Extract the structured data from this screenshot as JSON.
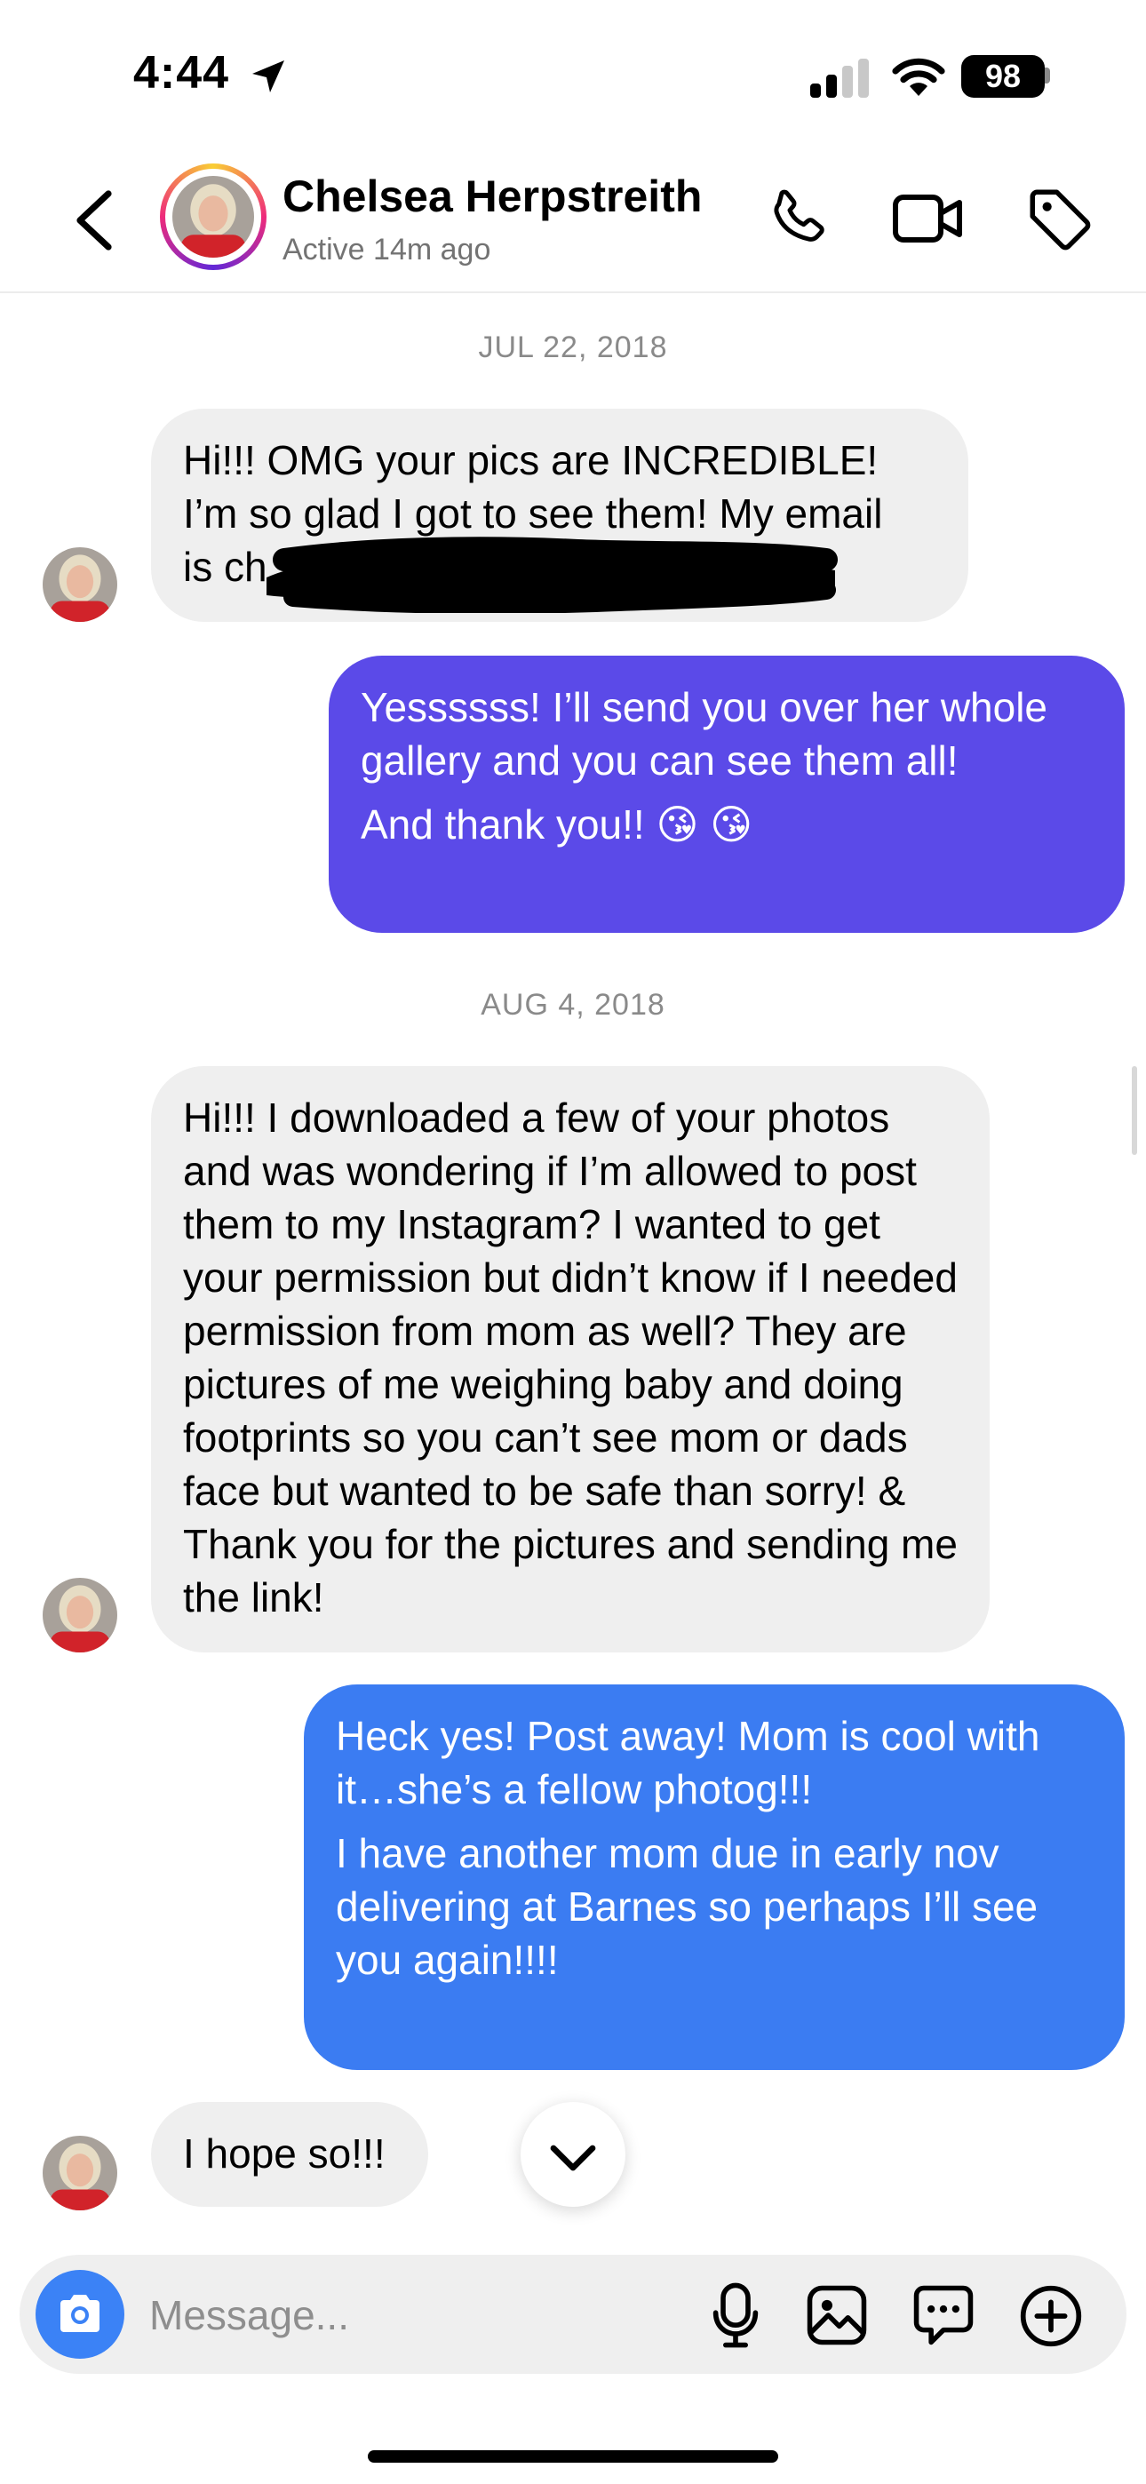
{
  "status_bar": {
    "time": "4:44",
    "battery": "98"
  },
  "header": {
    "name": "Chelsea Herpstreith",
    "status": "Active 14m ago"
  },
  "colors": {
    "outgoing_1": "#5b4ae8",
    "outgoing_2": "#3b7cf2",
    "incoming": "#efefef",
    "accent": "#3b82f6"
  },
  "messages": {
    "date_1": "JUL 22, 2018",
    "in_1": {
      "line1": "Hi!!! OMG your pics are INCREDIBLE!",
      "line2": "I’m so glad I got to see them! My email",
      "line3": "is ch"
    },
    "out_1": {
      "p1": "Yessssss! I’ll send you over her whole gallery and you can see them all!",
      "p2": "And thank you!! 😘 😘"
    },
    "date_2": "AUG 4, 2018",
    "in_2": "Hi!!! I downloaded a few of your photos and was wondering if I’m allowed to post them to my Instagram? I wanted to get your permission but didn’t know if I needed permission from mom as well? They are pictures of me weighing baby and doing footprints so you can’t see mom or dads face but wanted to be safe than sorry! & Thank you for the pictures and sending me the link!",
    "out_2": {
      "p1": "Heck yes! Post away! Mom is cool with it…she’s a fellow photog!!!",
      "p2": "I have another mom due in early nov delivering at Barnes so perhaps I’ll see you again!!!!"
    },
    "in_3": "I hope so!!!"
  },
  "composer": {
    "placeholder": "Message..."
  }
}
